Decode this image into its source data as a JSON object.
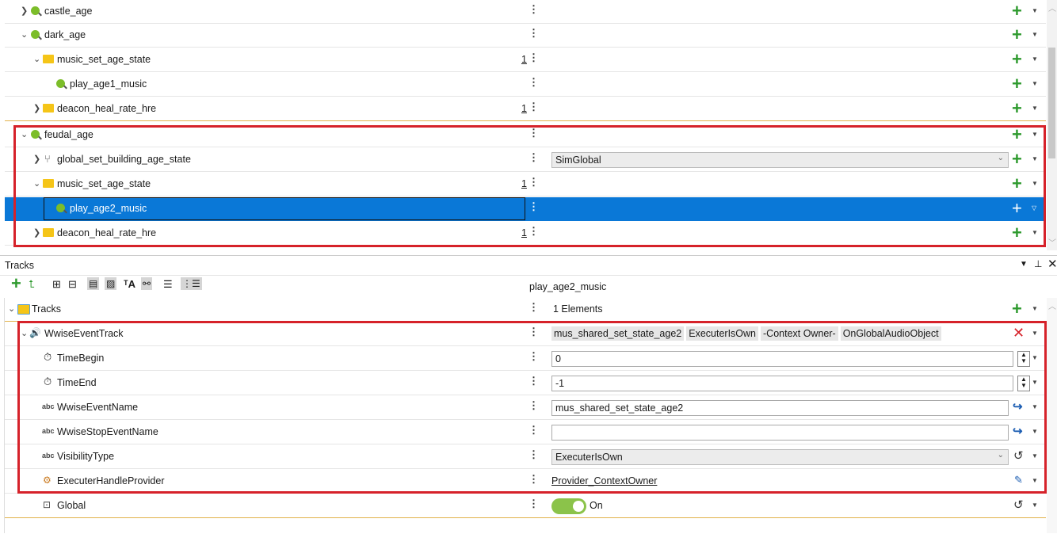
{
  "top_tree": {
    "rows": [
      {
        "label": "castle_age",
        "count": "",
        "expanded": false
      },
      {
        "label": "dark_age",
        "count": "",
        "expanded": true
      },
      {
        "label": "music_set_age_state",
        "count": "1",
        "expanded": true
      },
      {
        "label": "play_age1_music",
        "count": ""
      },
      {
        "label": "deacon_heal_rate_hre",
        "count": "1",
        "expanded": false
      },
      {
        "label": "feudal_age",
        "count": "",
        "expanded": true
      },
      {
        "label": "global_set_building_age_state",
        "count": "",
        "expanded": false,
        "value": "SimGlobal"
      },
      {
        "label": "music_set_age_state",
        "count": "1",
        "expanded": true
      },
      {
        "label": "play_age2_music",
        "count": "",
        "selected": true
      },
      {
        "label": "deacon_heal_rate_hre",
        "count": "1",
        "expanded": false
      }
    ]
  },
  "tracks_panel": {
    "title": "Tracks",
    "selected_node": "play_age2_music",
    "root": {
      "label": "Tracks",
      "value": "1 Elements"
    },
    "properties": [
      {
        "label": "WwiseEventTrack",
        "tags": [
          "mus_shared_set_state_age2",
          "ExecuterIsOwn",
          "-Context Owner-",
          "OnGlobalAudioObject"
        ]
      },
      {
        "label": "TimeBegin",
        "value": "0"
      },
      {
        "label": "TimeEnd",
        "value": "-1"
      },
      {
        "label": "WwiseEventName",
        "value": "mus_shared_set_state_age2"
      },
      {
        "label": "WwiseStopEventName",
        "value": ""
      },
      {
        "label": "VisibilityType",
        "value": "ExecuterIsOwn"
      },
      {
        "label": "ExecuterHandleProvider",
        "value": "Provider_ContextOwner"
      },
      {
        "label": "Global",
        "value": "On"
      }
    ],
    "abc_prefix": "abc"
  },
  "colors": {
    "accent_green": "#2e9a2e",
    "selection_blue": "#0a78d7",
    "highlight_red": "#d6222a",
    "toggle_green": "#8bc34a"
  }
}
